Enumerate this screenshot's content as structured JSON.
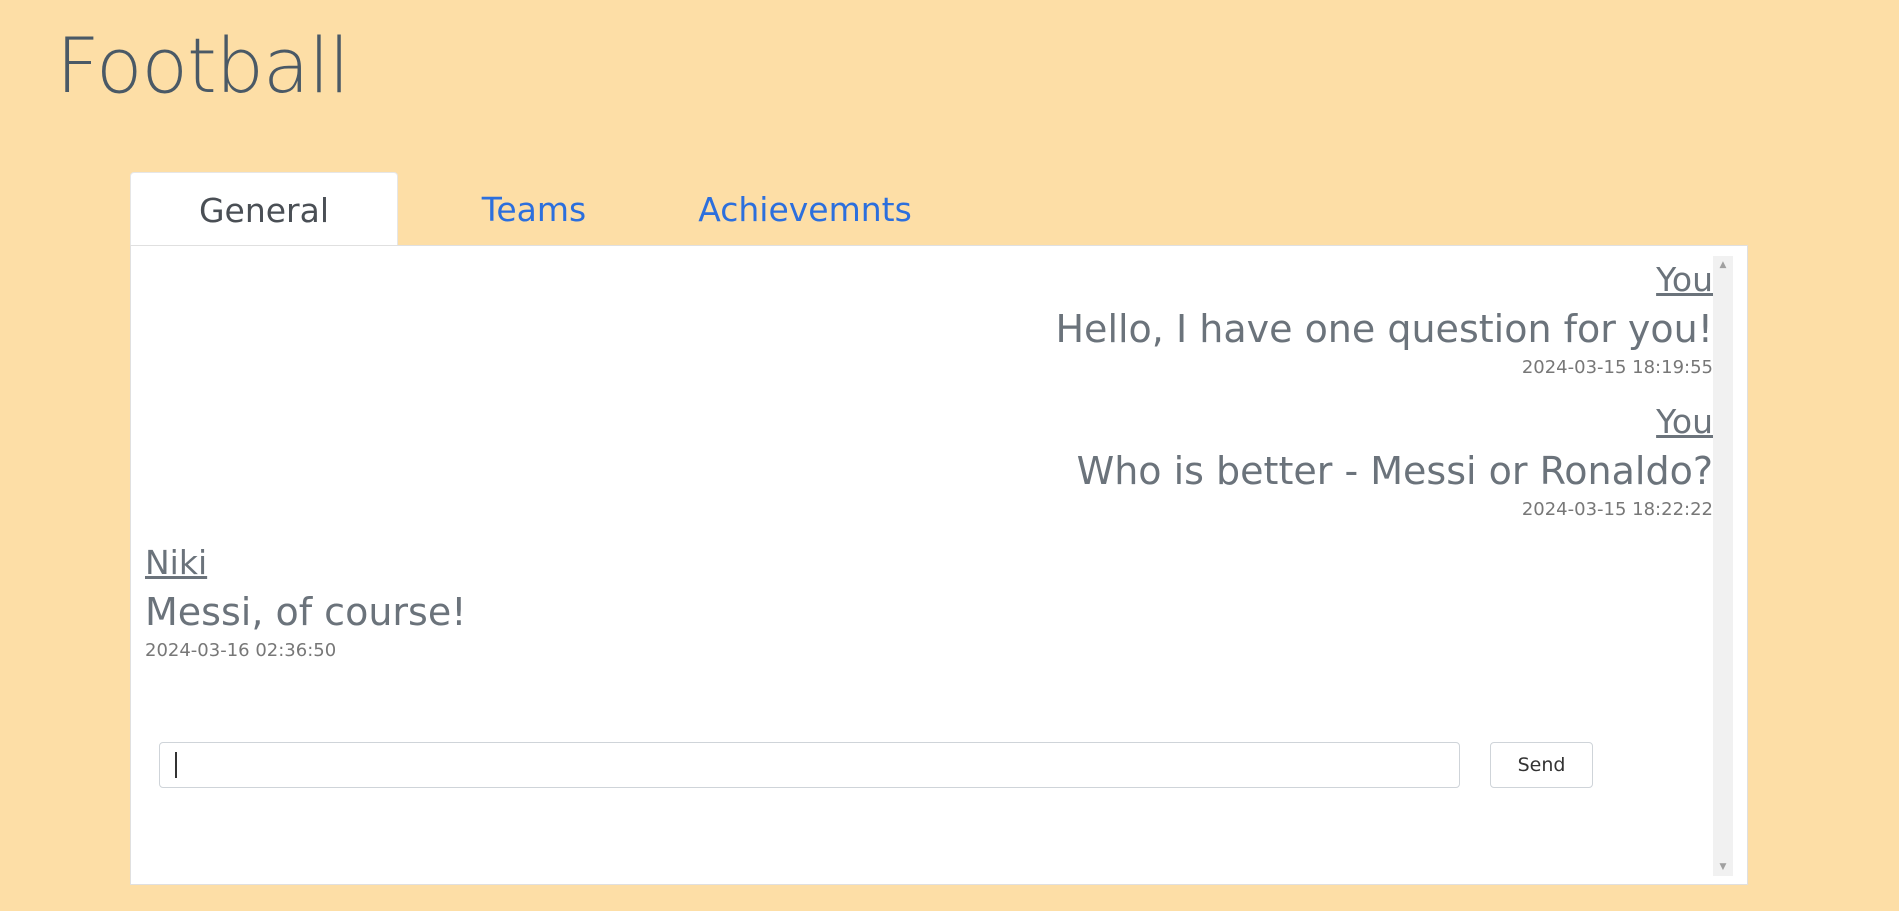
{
  "app": {
    "title": "Football"
  },
  "tabs": [
    {
      "label": "General",
      "active": true
    },
    {
      "label": "Teams",
      "active": false
    },
    {
      "label": "Achievemnts",
      "active": false
    }
  ],
  "messages": [
    {
      "author": "You",
      "text": "Hello, I have one question for you!",
      "time": "2024-03-15 18:19:55",
      "side": "right"
    },
    {
      "author": "You",
      "text": "Who is better - Messi or Ronaldo?",
      "time": "2024-03-15 18:22:22",
      "side": "right"
    },
    {
      "author": "Niki",
      "text": "Messi, of course!",
      "time": "2024-03-16 02:36:50",
      "side": "left"
    }
  ],
  "composer": {
    "value": "",
    "send_label": "Send"
  },
  "scrollbar": {
    "up_icon": "triangle-up-icon",
    "down_icon": "triangle-down-icon"
  },
  "colors": {
    "background": "#fddea6",
    "tab_link": "#2c6fdd",
    "title": "#4a5966",
    "message_text": "#6b737b"
  }
}
